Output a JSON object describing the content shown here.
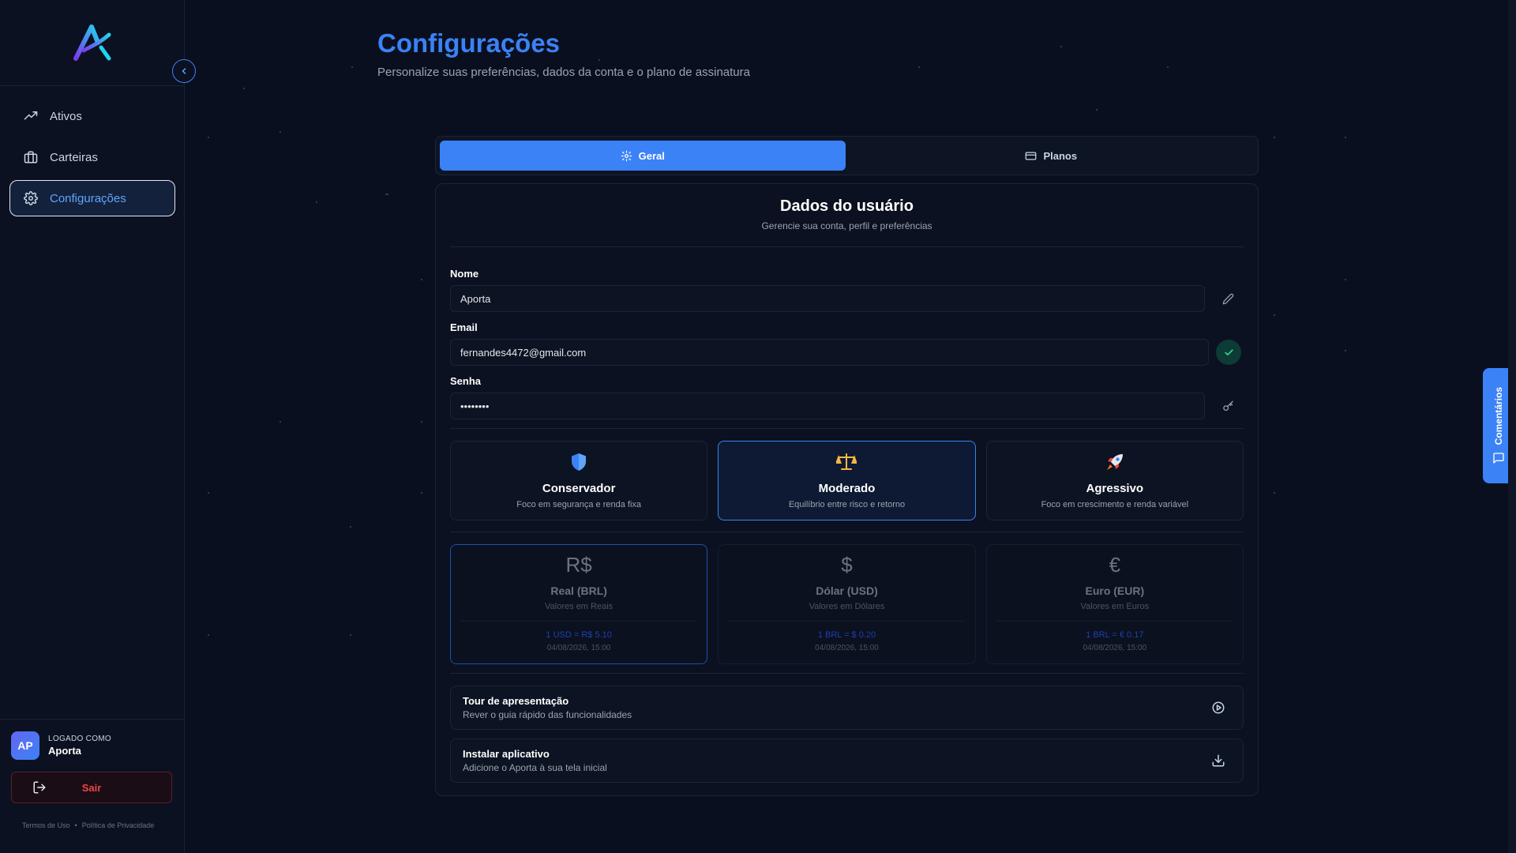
{
  "sidebar": {
    "collapse_icon": "chevron-left-icon",
    "items": [
      {
        "label": "Ativos",
        "icon": "trending-up-icon"
      },
      {
        "label": "Carteiras",
        "icon": "briefcase-icon"
      },
      {
        "label": "Configurações",
        "icon": "gear-icon",
        "active": true
      }
    ],
    "user": {
      "initials": "AP",
      "caption": "LOGADO COMO",
      "name": "Aporta"
    },
    "logout_label": "Sair",
    "legal": {
      "terms": "Termos de Uso",
      "separator": "•",
      "privacy": "Política de Privacidade"
    }
  },
  "header": {
    "title": "Configurações",
    "subtitle": "Personalize suas preferências, dados da conta e o plano de assinatura"
  },
  "tabs": [
    {
      "label": "Geral",
      "icon": "gear-icon",
      "active": true
    },
    {
      "label": "Planos",
      "icon": "credit-card-icon",
      "active": false
    }
  ],
  "user_data": {
    "title": "Dados do usuário",
    "subtitle": "Gerencie sua conta, perfil e preferências",
    "name": {
      "label": "Nome",
      "value": "Aporta"
    },
    "email": {
      "label": "Email",
      "value": "fernandes4472@gmail.com"
    },
    "password": {
      "label": "Senha",
      "value": "••••••••"
    }
  },
  "profiles": [
    {
      "title": "Conservador",
      "desc": "Foco em segurança e renda fixa",
      "icon": "shield-icon"
    },
    {
      "title": "Moderado",
      "desc": "Equilíbrio entre risco e retorno",
      "icon": "scales-icon",
      "active": true
    },
    {
      "title": "Agressivo",
      "desc": "Foco em crescimento e renda variável",
      "icon": "rocket-icon"
    }
  ],
  "currencies": [
    {
      "symbol": "R$",
      "title": "Real (BRL)",
      "desc": "Valores em Reais",
      "rate": "1 USD = R$ 5.10",
      "date": "04/08/2026, 15:00",
      "active": true
    },
    {
      "symbol": "$",
      "title": "Dólar (USD)",
      "desc": "Valores em Dólares",
      "rate": "1 BRL = $ 0.20",
      "date": "04/08/2026, 15:00"
    },
    {
      "symbol": "€",
      "title": "Euro (EUR)",
      "desc": "Valores em Euros",
      "rate": "1 BRL = € 0.17",
      "date": "04/08/2026, 15:00"
    }
  ],
  "actions": [
    {
      "title": "Tour de apresentação",
      "desc": "Rever o guia rápido das funcionalidades",
      "icon": "play-circle-icon"
    },
    {
      "title": "Instalar aplicativo",
      "desc": "Adicione o Aporta à sua tela inicial",
      "icon": "download-icon"
    }
  ],
  "feedback": {
    "label": "Comentários",
    "icon": "message-square-icon"
  },
  "colors": {
    "accent": "#3b82f6",
    "background": "#0a0f1f",
    "danger": "#ef4444",
    "success": "#34d399"
  }
}
